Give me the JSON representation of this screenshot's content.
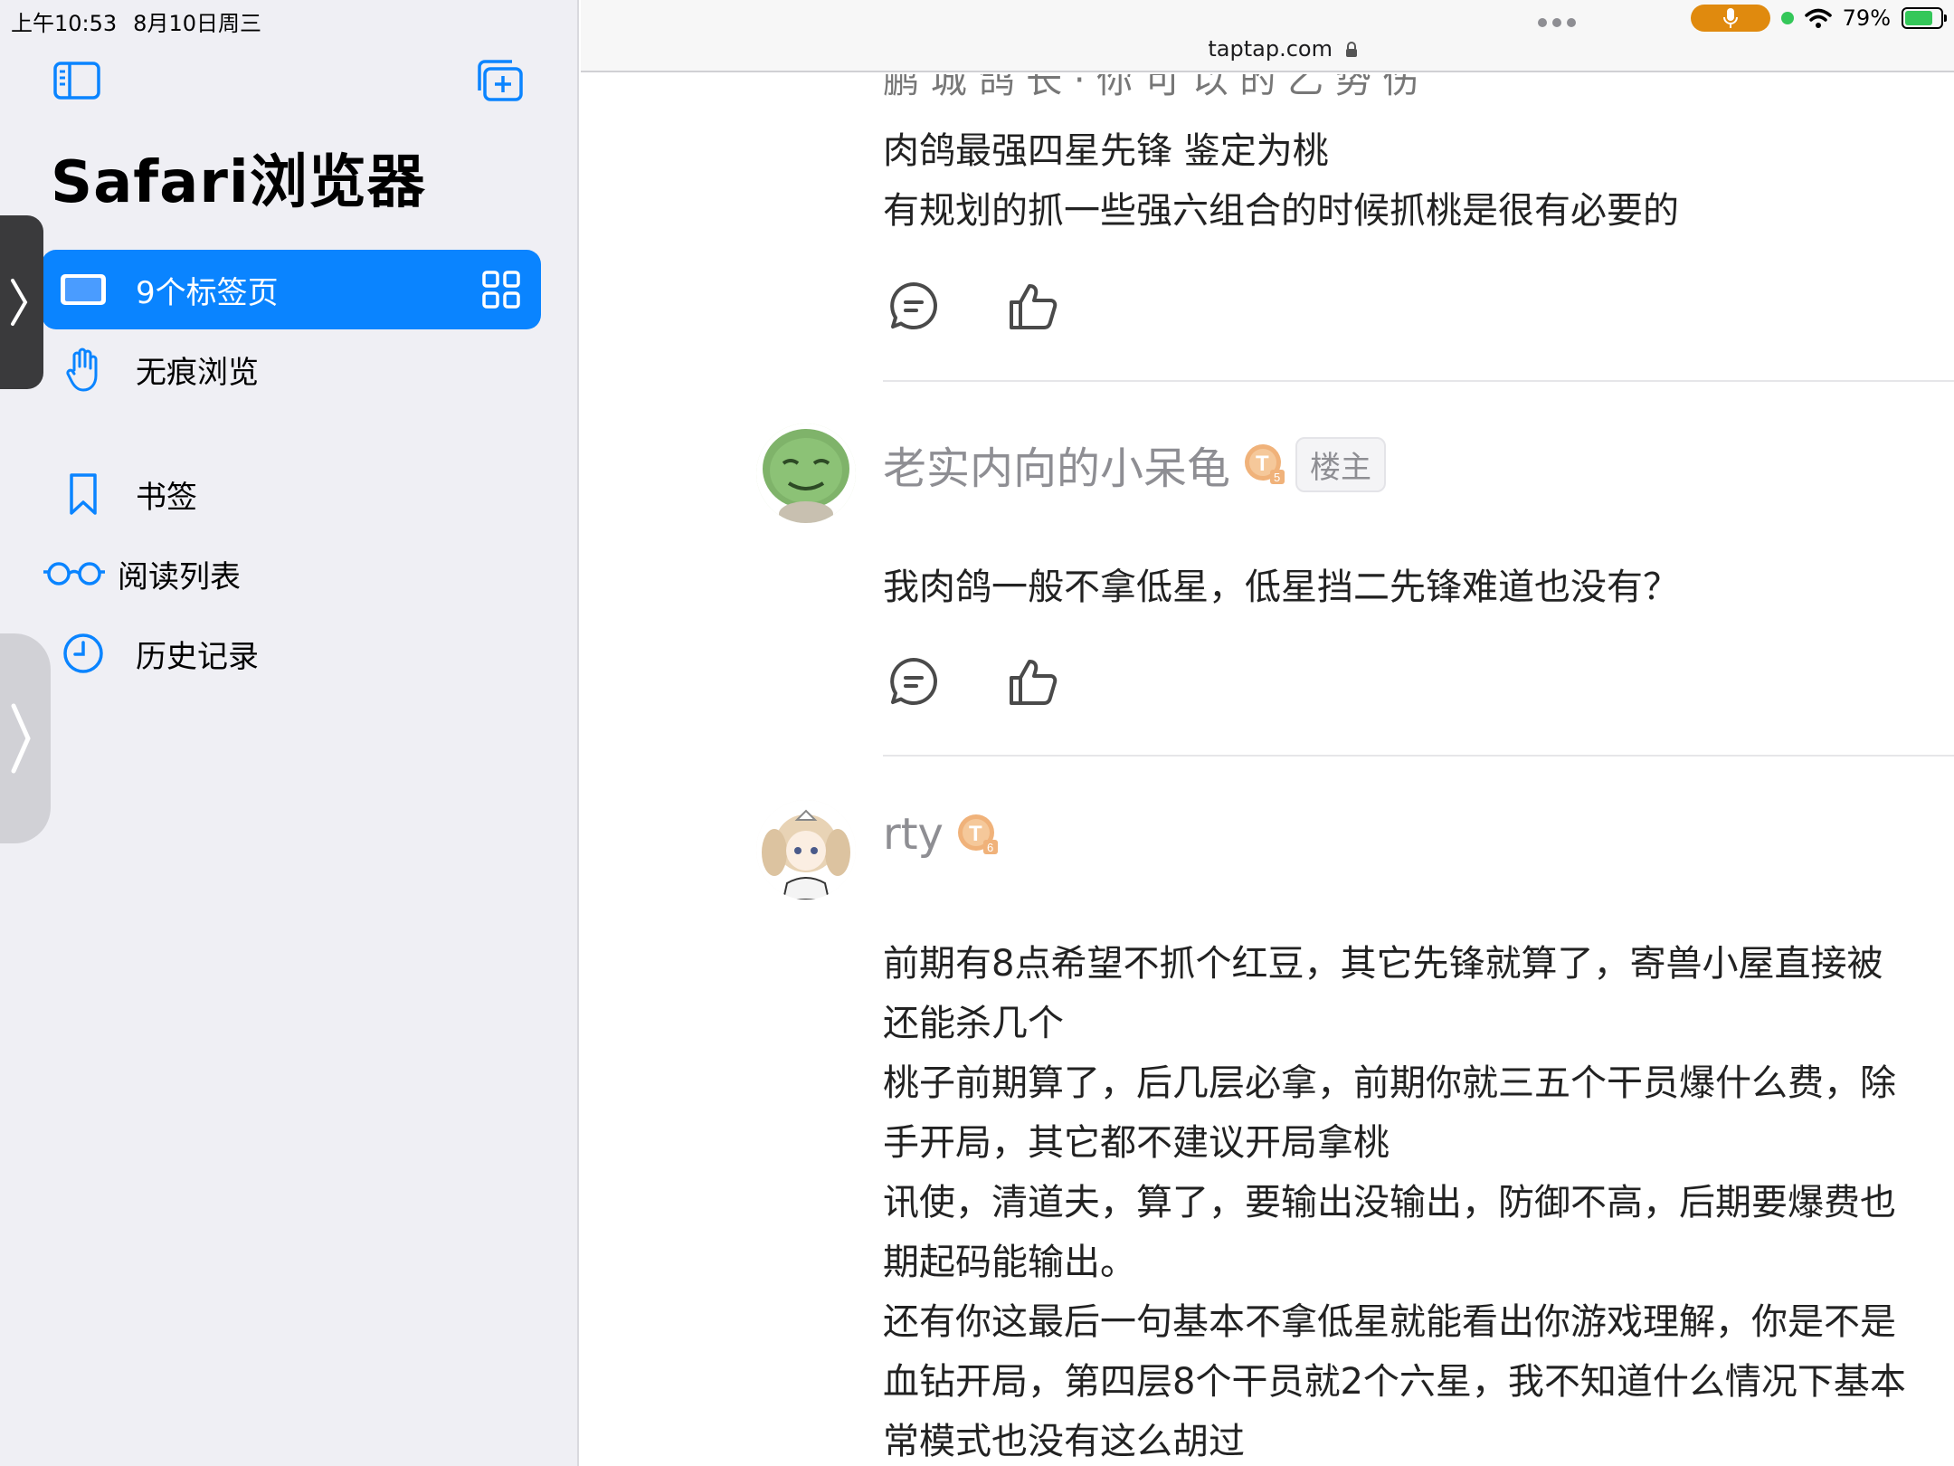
{
  "status": {
    "time": "上午10:53",
    "date": "8月10日周三",
    "battery": "79%"
  },
  "sidebar": {
    "title": "Safari浏览器",
    "items": [
      {
        "label": "9个标签页",
        "icon": "ipad-icon",
        "active": true
      },
      {
        "label": "无痕浏览",
        "icon": "hand-icon"
      },
      {
        "label": "书签",
        "icon": "bookmark-icon"
      },
      {
        "label": "阅读列表",
        "icon": "glasses-icon"
      },
      {
        "label": "历史记录",
        "icon": "clock-icon"
      }
    ]
  },
  "browser": {
    "url": "taptap.com"
  },
  "thread": {
    "cut_text": "鹏 城 鸽 长 · 你 可 以 的 乙 势 伤",
    "comment1_lines": [
      "肉鸽最强四星先锋 鉴定为桃",
      "有规划的抓一些强六组合的时候抓桃是很有必要的"
    ],
    "comment2": {
      "username": "老实内向的小呆龟",
      "badge": "T",
      "badge_level": "5",
      "host_tag": "楼主",
      "text": "我肉鸽一般不拿低星，低星挡二先锋难道也没有？"
    },
    "comment3": {
      "username": "rty",
      "badge": "T",
      "badge_level": "6",
      "lines": [
        "前期有8点希望不抓个红豆，其它先锋就算了，寄兽小屋直接被",
        "还能杀几个",
        "桃子前期算了，后几层必拿，前期你就三五个干员爆什么费，除",
        "手开局，其它都不建议开局拿桃",
        "讯使，清道夫，算了，要输出没输出，防御不高，后期要爆费也",
        "期起码能输出。",
        "还有你这最后一句基本不拿低星就能看出你游戏理解，你是不是",
        "血钻开局，第四层8个干员就2个六星，我不知道什么情况下基本",
        "常模式也没有这么胡过"
      ]
    }
  },
  "colors": {
    "accent": "#0a84ff",
    "sidebar_bg": "#efeff4",
    "mic": "#e08a0e"
  }
}
